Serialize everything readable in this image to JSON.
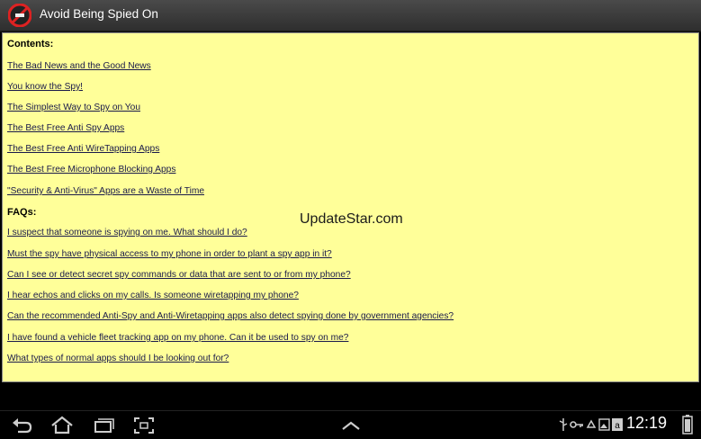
{
  "app": {
    "title": "Avoid Being Spied On",
    "icon": "no-spy-logo-icon"
  },
  "content": {
    "contents_heading": "Contents:",
    "contents_links": [
      "The Bad News and the Good News",
      "You know the Spy!",
      "The Simplest Way to Spy on You",
      "The Best Free Anti Spy Apps",
      "The Best Free Anti WireTapping Apps",
      "The Best Free Microphone Blocking Apps",
      "\"Security & Anti-Virus\" Apps are a Waste of Time"
    ],
    "faqs_heading": "FAQs:",
    "faq_links": [
      "I suspect that someone is spying on me. What should I do?",
      "Must the spy have physical access to my phone in order to plant a spy app in it?",
      "Can I see or detect secret spy commands or data that are sent to or from my phone?",
      "I hear echos and clicks on my calls. Is someone wiretapping my phone?",
      "Can the recommended Anti-Spy and Anti-Wiretapping apps also detect spying done by government agencies?",
      "I have found a vehicle fleet tracking app on my phone. Can it be used to spy on me?",
      "What types of normal apps should I be looking out for?"
    ],
    "background_color": "#ffff99"
  },
  "watermark": "UpdateStar.com",
  "navbar": {
    "buttons": [
      "back-icon",
      "home-icon",
      "recent-apps-icon",
      "screenshot-icon",
      "up-chevron-icon"
    ]
  },
  "status_bar": {
    "icons": [
      "usb-icon",
      "key-icon",
      "recycle-icon",
      "image-icon",
      "amazon-icon",
      "battery-icon"
    ],
    "time": "12:19"
  }
}
